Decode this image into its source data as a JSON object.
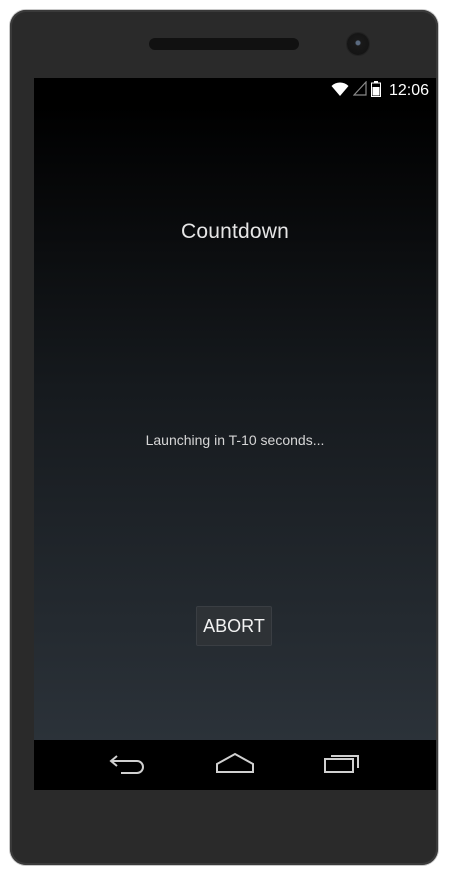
{
  "status_bar": {
    "time": "12:06",
    "icons": [
      "wifi-icon",
      "signal-icon",
      "battery-icon"
    ]
  },
  "app": {
    "title": "Countdown",
    "message": "Launching in T-10 seconds...",
    "abort_label": "ABORT"
  },
  "nav_bar": {
    "buttons": [
      "back-icon",
      "home-icon",
      "recent-apps-icon"
    ]
  },
  "colors": {
    "device_body": "#2a2a2a",
    "screen_top": "#000000",
    "screen_bottom": "#2b3239",
    "text": "#e6e6e6"
  }
}
